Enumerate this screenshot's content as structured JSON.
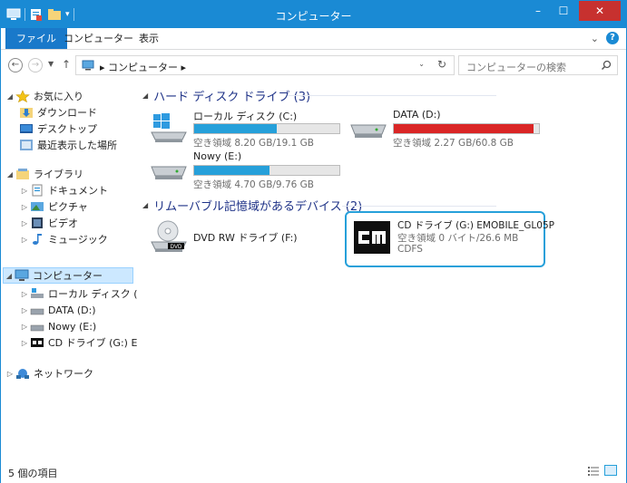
{
  "window": {
    "title": "コンピューター",
    "minimize": "–",
    "maximize": "☐",
    "close": "✕"
  },
  "ribbon": {
    "tabs": [
      "ファイル",
      "コンピューター",
      "表示"
    ],
    "expand": "⌄",
    "help": "?"
  },
  "address": {
    "path": "コンピューター",
    "search_placeholder": "コンピューターの検索"
  },
  "nav_pane": {
    "favorites_label": "お気に入り",
    "favorites": [
      "ダウンロード",
      "デスクトップ",
      "最近表示した場所"
    ],
    "libraries_label": "ライブラリ",
    "libraries": [
      "ドキュメント",
      "ピクチャ",
      "ビデオ",
      "ミュージック"
    ],
    "computer_label": "コンピューター",
    "computer_items": [
      "ローカル ディスク (C:)",
      "DATA (D:)",
      "Nowy (E:)",
      "CD ドライブ (G:) EM"
    ],
    "network_label": "ネットワーク"
  },
  "content": {
    "hdd_group": "ハード ディスク ドライブ (3)",
    "removable_group": "リムーバブル記憶域があるデバイス (2)",
    "drives": [
      {
        "name": "ローカル ディスク (C:)",
        "free": "空き領域 8.20 GB/19.1 GB",
        "used_fraction": 0.57,
        "full": false
      },
      {
        "name": "DATA (D:)",
        "free": "空き領域 2.27 GB/60.8 GB",
        "used_fraction": 0.96,
        "full": true
      },
      {
        "name": "Nowy (E:)",
        "free": "空き領域 4.70 GB/9.76 GB",
        "used_fraction": 0.52,
        "full": false
      }
    ],
    "dvd_drive": {
      "name": "DVD RW ドライブ (F:)",
      "icon_label": "DVD"
    },
    "cd_drive": {
      "name": "CD ドライブ (G:) EMOBILE_GL05P",
      "free": "空き領域 0 バイト/26.6 MB",
      "fs": "CDFS"
    }
  },
  "status": {
    "item_count": "5 個の項目"
  },
  "colors": {
    "accent": "#1a8ad4",
    "bar_normal": "#26a0da",
    "bar_full": "#da2626",
    "group_header": "#1e3287"
  }
}
